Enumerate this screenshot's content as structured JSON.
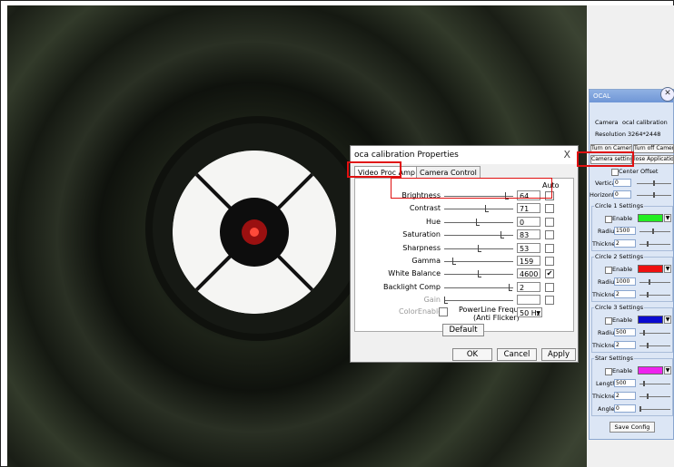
{
  "properties_dialog": {
    "title": "oca calibration Properties",
    "close_glyph": "X",
    "tabs": [
      {
        "label": "Video Proc Amp",
        "selected": true
      },
      {
        "label": "Camera Control",
        "selected": false
      }
    ],
    "auto_header": "Auto",
    "properties": [
      {
        "label": "Brightness",
        "value": "64",
        "auto": "",
        "slider_fraction": 0.93,
        "enabled": true
      },
      {
        "label": "Contrast",
        "value": "71",
        "auto": "",
        "slider_fraction": 0.62,
        "enabled": true
      },
      {
        "label": "Hue",
        "value": "0",
        "auto": "",
        "slider_fraction": 0.48,
        "enabled": true
      },
      {
        "label": "Saturation",
        "value": "83",
        "auto": "",
        "slider_fraction": 0.86,
        "enabled": true
      },
      {
        "label": "Sharpness",
        "value": "53",
        "auto": "",
        "slider_fraction": 0.52,
        "enabled": true
      },
      {
        "label": "Gamma",
        "value": "159",
        "auto": "",
        "slider_fraction": 0.12,
        "enabled": true
      },
      {
        "label": "White Balance",
        "value": "4600",
        "auto": "✔",
        "slider_fraction": 0.52,
        "enabled": true
      },
      {
        "label": "Backlight Comp",
        "value": "2",
        "auto": "",
        "slider_fraction": 0.98,
        "enabled": true
      },
      {
        "label": "Gain",
        "value": "",
        "auto": "",
        "slider_fraction": 0.0,
        "enabled": false
      }
    ],
    "color_enable_label": "ColorEnable",
    "powerline_label_1": "PowerLine Frequency",
    "powerline_label_2": "(Anti Flicker)",
    "powerline_value": "50 Hz",
    "default_button": "Default",
    "ok_button": "OK",
    "cancel_button": "Cancel",
    "apply_button": "Apply"
  },
  "ocal_panel": {
    "title": "OCAL",
    "close_glyph": "✕",
    "camera_label": "Camera",
    "camera_value": "ocal calibration",
    "resolution_label": "Resolution",
    "resolution_value": "3264*2448",
    "turn_on_camera": "Turn on Camera",
    "turn_off_camera": "Turn off Camera",
    "camera_settings": "Camera settings",
    "close_application": "lose Application",
    "center_offset": "Center Offset",
    "vertical_label": "Vertical",
    "vertical_value": "0",
    "horizontal_label": "Horizontal",
    "horizontal_value": "0",
    "circle1": {
      "title": "Circle 1 Settings",
      "enable": "Enable",
      "color": "#22ee22",
      "radius_label": "Radius",
      "radius": "1500",
      "thickness_label": "Thickness",
      "thickness": "2"
    },
    "circle2": {
      "title": "Circle 2 Settings",
      "enable": "Enable",
      "color": "#ee1111",
      "radius_label": "Radius",
      "radius": "1000",
      "thickness_label": "Thickness",
      "thickness": "2"
    },
    "circle3": {
      "title": "Circle 3 Settings",
      "enable": "Enable",
      "color": "#0a0ad0",
      "radius_label": "Radius",
      "radius": "500",
      "thickness_label": "Thickness",
      "thickness": "2"
    },
    "star": {
      "title": "Star Settings",
      "enable": "Enable",
      "color": "#ee22ee",
      "length_label": "Length",
      "length": "500",
      "thickness_label": "Thickness",
      "thickness": "2",
      "angle_label": "Angle",
      "angle": "0"
    },
    "save_config": "Save Config"
  }
}
